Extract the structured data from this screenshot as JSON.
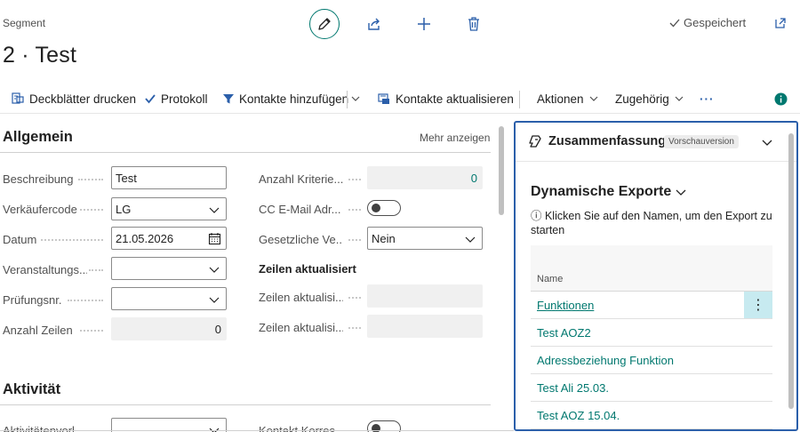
{
  "header": {
    "caption": "Segment",
    "title": "2 · Test",
    "saved_status": "Gespeichert"
  },
  "actions": [
    {
      "label": "Deckblätter drucken",
      "icon": "print-icon"
    },
    {
      "label": "Protokoll",
      "icon": "check-icon"
    },
    {
      "label": "Kontakte hinzufügen",
      "icon": "filter-icon"
    },
    {
      "label": "Kontakte aktualisieren",
      "icon": "refresh-contacts-icon"
    },
    {
      "label": "Aktionen"
    },
    {
      "label": "Zugehörig"
    }
  ],
  "more_actions": "···",
  "general": {
    "title": "Allgemein",
    "show_more": "Mehr anzeigen",
    "beschreibung_label": "Beschreibung",
    "beschreibung_value": "Test",
    "verkaeufercode_label": "Verkäufercode",
    "verkaeufercode_value": "LG",
    "datum_label": "Datum",
    "datum_value": "21.05.2026",
    "veranstaltung_label": "Veranstaltungs...",
    "veranstaltung_value": "",
    "pruefung_label": "Prüfungsnr.",
    "pruefung_value": "",
    "anzahl_zeilen_label": "Anzahl Zeilen",
    "anzahl_zeilen_value": "0",
    "anzahl_kriterien_label": "Anzahl Kriterie...",
    "anzahl_kriterien_value": "0",
    "cc_email_label": "CC E-Mail Adr...",
    "gesetzlich_label": "Gesetzliche Ve...",
    "gesetzlich_value": "Nein",
    "zeilen_akt_header": "Zeilen aktualisiert",
    "zeilen_akt_1_label": "Zeilen aktualisi...",
    "zeilen_akt_2_label": "Zeilen aktualisi..."
  },
  "activity": {
    "title": "Aktivität",
    "field1_label": "Aktivitätenvorl...",
    "field2_label": "Kontakt Korres..."
  },
  "factbox": {
    "title": "Zusammenfassung",
    "badge": "Vorschauversion",
    "section_title": "Dynamische Exporte",
    "hint": "ⓘ Klicken Sie auf den Namen, um den Export zu starten",
    "column_name": "Name",
    "rows": [
      "Funktionen",
      "Test AOZ2",
      "Adressbeziehung Funktion",
      "Test Ali 25.03.",
      "Test AOZ 15.04."
    ],
    "row_menu": "⋮"
  },
  "colors": {
    "accent": "#00786f",
    "focus_border": "#2b5faa",
    "selected_row_bg": "#c7eaf0"
  }
}
